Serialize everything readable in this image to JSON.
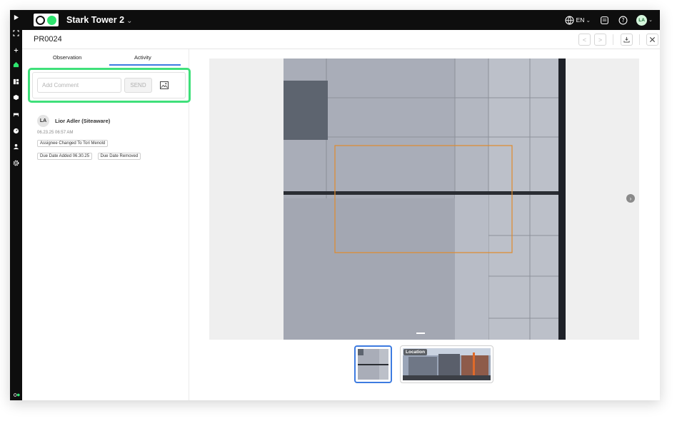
{
  "topbar": {
    "project_name": "Stark Tower 2",
    "language": "EN",
    "user_initials": "LA",
    "icons": [
      "globe-icon",
      "chat-icon",
      "help-icon"
    ]
  },
  "record": {
    "id": "PR0024"
  },
  "tabs": [
    {
      "label": "Observation",
      "active": false
    },
    {
      "label": "Activity",
      "active": true
    }
  ],
  "comment": {
    "placeholder": "Add Comment",
    "value": "",
    "send_label": "SEND"
  },
  "activity": {
    "initials": "LA",
    "user": "Lior Adler (Siteaware)",
    "timestamp": "06.23.25 06:57 AM",
    "changes": [
      "Assignee Changed To Tori Menold",
      "Due Date Added 06.30.25",
      "Due Date Removed"
    ]
  },
  "gallery": {
    "location_label": "Location",
    "active_index": 0
  },
  "colors": {
    "accent": "#3d7be0",
    "brand_green": "#2ee56f",
    "highlight": "#3fe07a",
    "annotation": "#e08a2c"
  }
}
